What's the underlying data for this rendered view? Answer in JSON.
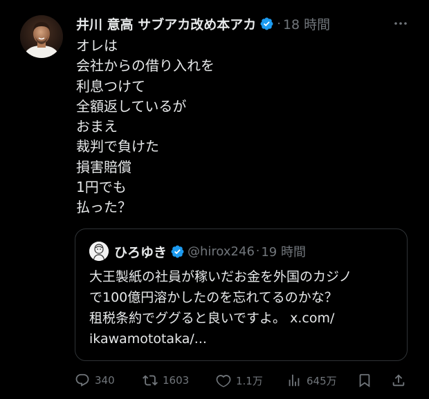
{
  "tweet": {
    "author_name": "井川 意高 サブアカ改め本アカ",
    "dot": "·",
    "time": "18 時間",
    "body_lines": [
      "オレは",
      "会社からの借り入れを",
      "利息つけて",
      "全額返しているが",
      "おまえ",
      "裁判で負けた",
      "損害賠償",
      "1円でも",
      "払った？"
    ]
  },
  "quote": {
    "author_name": "ひろゆき",
    "handle": "@hirox246",
    "dot": "·",
    "time": "19 時間",
    "text_lines": [
      "大王製紙の社員が稼いだお金を外国のカジノ",
      "で100億円溶かしたのを忘れてるのかな？",
      "租税条約でググると良いですよ。 x.com/",
      "ikawamototaka/..."
    ]
  },
  "actions": {
    "replies": "340",
    "retweets": "1603",
    "likes": "1.1万",
    "views": "645万"
  },
  "colors": {
    "background": "#000000",
    "text_primary": "#e7e9ea",
    "text_secondary": "#71767b",
    "verified_blue": "#1d9bf0",
    "border": "#2f3336"
  },
  "icons": [
    "more-icon",
    "verified-badge-icon",
    "reply-icon",
    "retweet-icon",
    "like-icon",
    "views-icon",
    "bookmark-icon",
    "share-icon"
  ]
}
